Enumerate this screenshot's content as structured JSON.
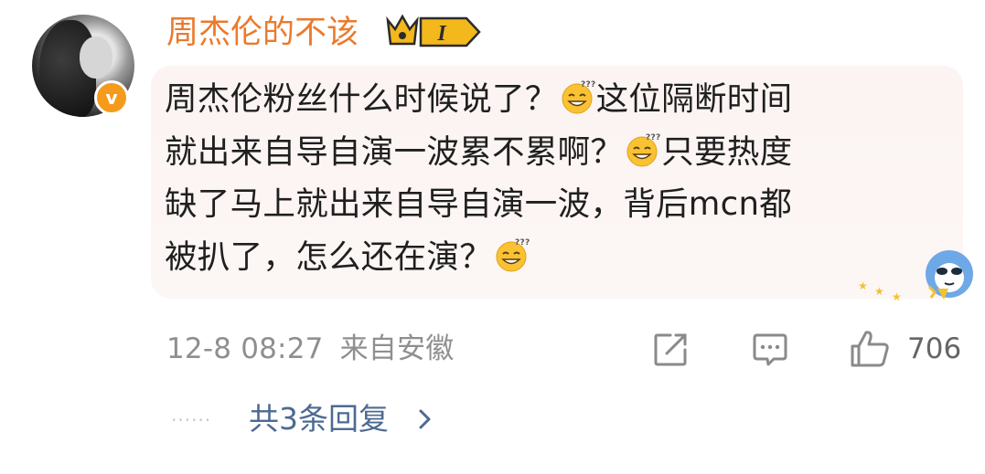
{
  "comment": {
    "author": {
      "name": "周杰伦的不该",
      "level_badge": "I",
      "verified": true,
      "avatar": "avatar-photo"
    },
    "text_lines": [
      {
        "text": "周杰伦粉丝什么时候说了？",
        "emoji_after": true,
        "suffix": "这位隔断时间"
      },
      {
        "text": "就出来自导自演一波累不累啊？",
        "emoji_after": true,
        "suffix": "只要热度"
      },
      {
        "text": "缺了马上就出来自导自演一波，背后mcn都",
        "emoji_after": false,
        "suffix": ""
      },
      {
        "text": "被扒了，怎么还在演？",
        "emoji_after": true,
        "suffix": ""
      }
    ],
    "emoji_icon": "thinking-grin-emoji",
    "meta": {
      "timestamp": "12-8 08:27",
      "location": "来自安徽"
    },
    "actions": {
      "share_icon": "share-icon",
      "comment_icon": "comment-icon",
      "like_icon": "thumbs-up-icon",
      "like_count": "706"
    },
    "replies": {
      "dots": "······",
      "label": "共3条回复",
      "chevron_icon": "chevron-right-icon"
    }
  },
  "colors": {
    "username": "#eb7a2c",
    "verified": "#f59a1b",
    "bubble": "#fbf4f2",
    "meta": "#8f8f8f",
    "replies_link": "#4d6a92"
  }
}
